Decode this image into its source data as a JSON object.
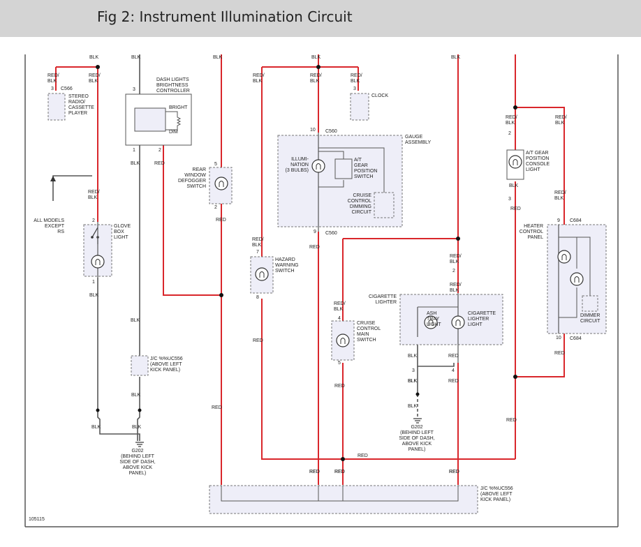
{
  "header": {
    "title": "Fig 2: Instrument Illumination Circuit"
  },
  "figure_id": "105115",
  "components": {
    "c566": "C566",
    "stereo": [
      "STEREO",
      "RADIO/",
      "CASSETTE",
      "PLAYER"
    ],
    "dash_ctrl": [
      "DASH LIGHTS",
      "BRIGHTNESS",
      "CONTROLLER"
    ],
    "bright": "BRIGHT",
    "dim": "DIM",
    "rear_def": [
      "REAR",
      "WINDOW",
      "DEFOGGER",
      "SWITCH"
    ],
    "clock": "CLOCK",
    "gauge": [
      "GAUGE",
      "ASSEMBLY"
    ],
    "c560_top": "C560",
    "c560_bot": "C560",
    "illum": [
      "ILLUMI-",
      "NATION",
      "(3 BULBS)"
    ],
    "at_sw": [
      "A/T",
      "GEAR",
      "POSITION",
      "SWITCH"
    ],
    "cruise_dim": [
      "CRUISE",
      "CONTROL",
      "DIMMING",
      "CIRCUIT"
    ],
    "hazard": [
      "HAZARD",
      "WARNING",
      "SWITCH"
    ],
    "at_console": [
      "A/T GEAR",
      "POSITION",
      "CONSOLE",
      "LIGHT"
    ],
    "heater": [
      "HEATER",
      "CONTROL",
      "PANEL"
    ],
    "c684_top": "C684",
    "c684_bot": "C684",
    "dimmer": [
      "DIMMER",
      "CIRCUIT"
    ],
    "all_models": [
      "ALL MODELS",
      "EXCEPT",
      "RS"
    ],
    "glove": [
      "GLOVE",
      "BOX",
      "LIGHT"
    ],
    "cig_lighter_hdr": [
      "CIGARETTE",
      "LIGHTER"
    ],
    "ash": [
      "ASH",
      "TRAY",
      "LIGHT"
    ],
    "cig": [
      "CIGARETTE",
      "LIGHTER",
      "LIGHT"
    ],
    "cruise_main": [
      "CRUISE",
      "CONTROL",
      "MAIN",
      "SWITCH"
    ],
    "jc_left": [
      "J/C %%UC556",
      "(ABOVE LEFT",
      "KICK PANEL)"
    ],
    "g202_left": [
      "G202",
      "(BEHIND LEFT",
      "SIDE OF DASH,",
      "ABOVE KICK",
      "PANEL)"
    ],
    "g202_right": [
      "G202",
      "(BEHIND LEFT",
      "SIDE OF DASH,",
      "ABOVE KICK",
      "PANEL)"
    ],
    "jc_bottom": [
      "J/C %%UC556",
      "(ABOVE LEFT",
      "KICK PANEL)"
    ]
  },
  "wire_labels": [
    {
      "t": "BLK"
    },
    {
      "t": "BLK"
    },
    {
      "t": "BLK"
    },
    {
      "t": "BLK"
    },
    {
      "t": "BLK"
    },
    {
      "t": "RED/"
    },
    {
      "t": "BLK"
    },
    {
      "t": "RED/"
    },
    {
      "t": "BLK"
    },
    {
      "t": "RED/"
    },
    {
      "t": "BLK"
    },
    {
      "t": "RED/"
    },
    {
      "t": "BLK"
    },
    {
      "t": "RED/"
    },
    {
      "t": "BLK"
    },
    {
      "t": "BLK"
    },
    {
      "t": "RED"
    },
    {
      "t": "RED/"
    },
    {
      "t": "BLK"
    },
    {
      "t": "RED"
    },
    {
      "t": "RED/"
    },
    {
      "t": "BLK"
    },
    {
      "t": "RED"
    },
    {
      "t": "BLK"
    },
    {
      "t": "BLK"
    },
    {
      "t": "BLK"
    },
    {
      "t": "BLK"
    },
    {
      "t": "BLK"
    },
    {
      "t": "BLK"
    },
    {
      "t": "RED"
    },
    {
      "t": "RED"
    },
    {
      "t": "RED"
    },
    {
      "t": "RED"
    },
    {
      "t": "RED/"
    },
    {
      "t": "BLK"
    },
    {
      "t": "RED/"
    },
    {
      "t": "BLK"
    },
    {
      "t": "RED/"
    },
    {
      "t": "BLK"
    },
    {
      "t": "RED/"
    },
    {
      "t": "BLK"
    },
    {
      "t": "BLK"
    },
    {
      "t": "RED"
    },
    {
      "t": "RED/"
    },
    {
      "t": "BLK"
    },
    {
      "t": "RED/"
    },
    {
      "t": "BLK"
    },
    {
      "t": "RED"
    },
    {
      "t": "BLK"
    },
    {
      "t": "RED"
    },
    {
      "t": "BLK"
    },
    {
      "t": "RED"
    },
    {
      "t": "BLK"
    },
    {
      "t": "RED"
    },
    {
      "t": "RED"
    },
    {
      "t": "RED"
    },
    {
      "t": "RED"
    },
    {
      "t": "RED"
    },
    {
      "t": "RED"
    },
    {
      "t": "RED"
    }
  ],
  "pins": [
    "3",
    "3",
    "1",
    "2",
    "5",
    "2",
    "3",
    "10",
    "9",
    "7",
    "8",
    "2",
    "3",
    "2",
    "4",
    "5",
    "3",
    "4",
    "9",
    "10",
    "2",
    "1"
  ]
}
